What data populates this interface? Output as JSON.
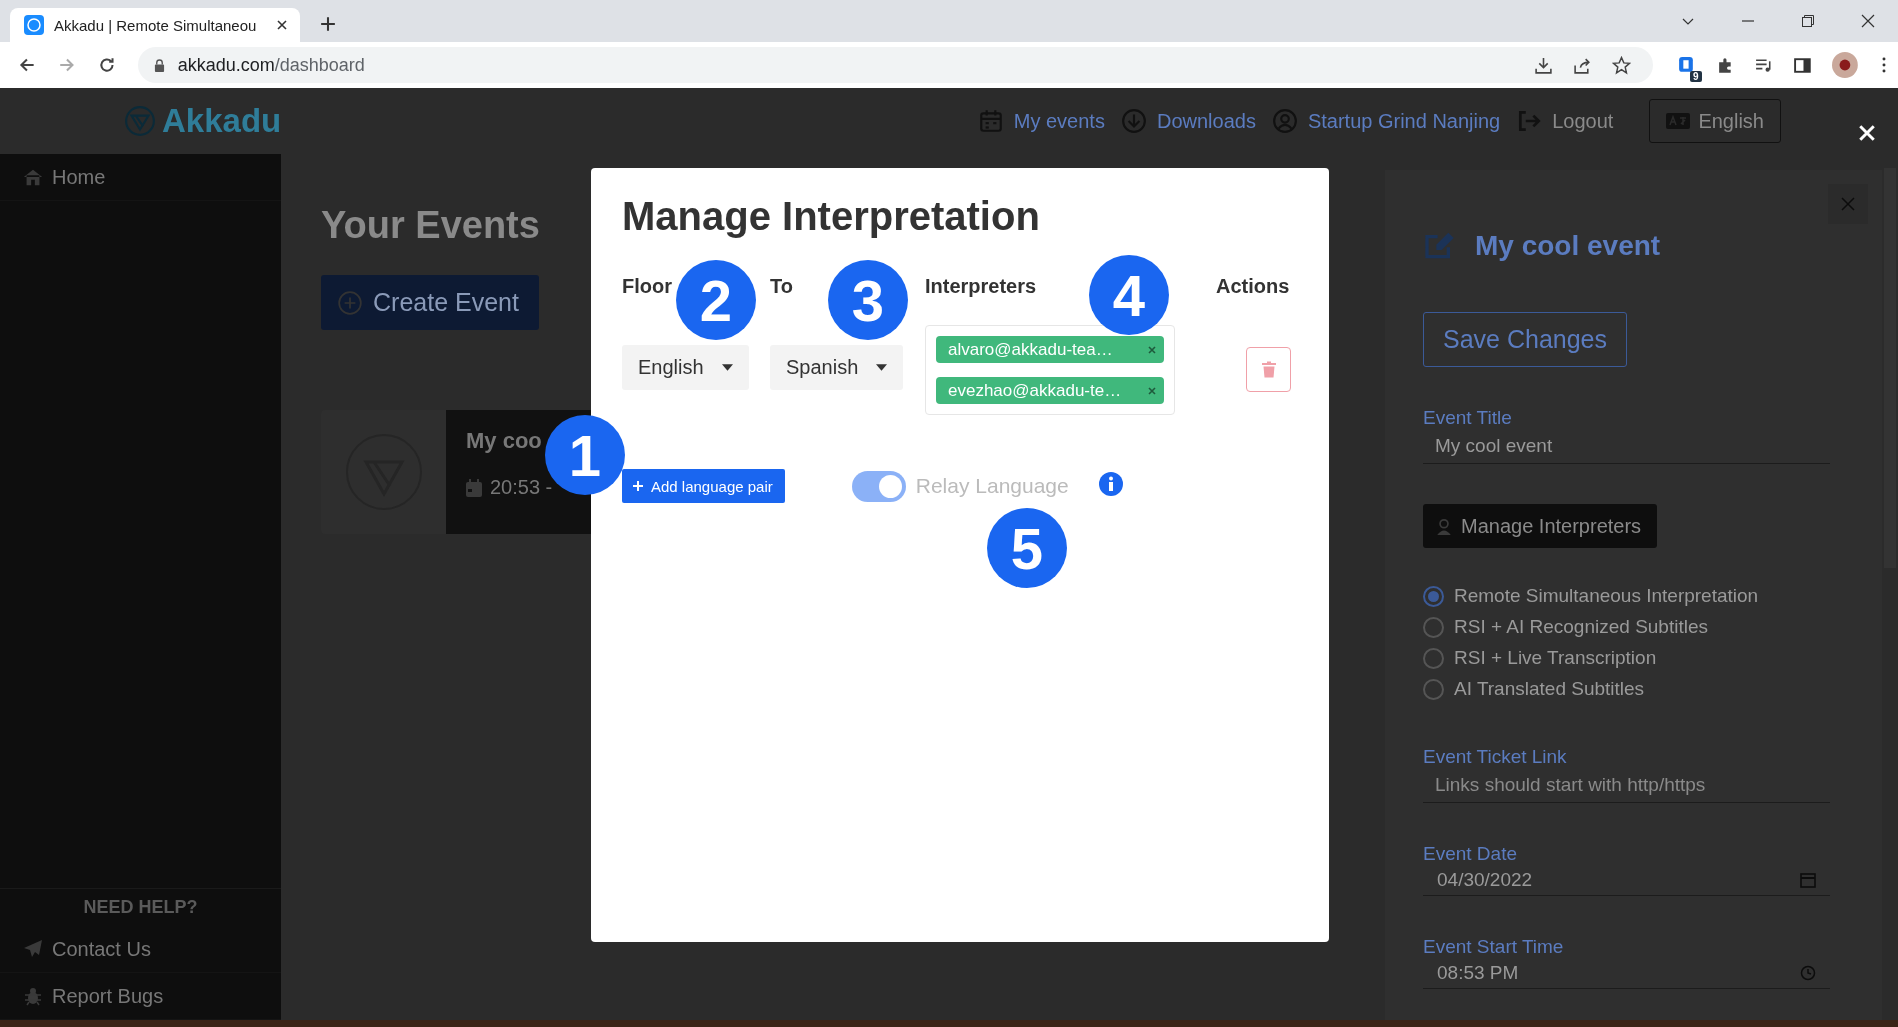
{
  "browser": {
    "tab_title": "Akkadu | Remote Simultaneou",
    "url_host": "akkadu.com",
    "url_path": "/dashboard",
    "extension_badge": "9"
  },
  "app_header": {
    "logo": "Akkadu",
    "nav": [
      {
        "label": "My events"
      },
      {
        "label": "Downloads"
      },
      {
        "label": "Startup Grind Nanjing"
      },
      {
        "label": "Logout"
      }
    ],
    "language_button": "English"
  },
  "sidebar": {
    "items": [
      "Home"
    ],
    "help_heading": "NEED HELP?",
    "help_items": [
      {
        "label": "Contact Us"
      },
      {
        "label": "Report Bugs"
      }
    ]
  },
  "main": {
    "title": "Your Events",
    "create_button": "Create Event",
    "event_card": {
      "title": "My coo",
      "time": "20:53 -"
    }
  },
  "event_panel": {
    "title": "My cool event",
    "save_button": "Save Changes",
    "title_label": "Event Title",
    "title_value": "My cool event",
    "manage_button": "Manage Interpreters",
    "modes": [
      {
        "label": "Remote Simultaneous Interpretation",
        "selected": true
      },
      {
        "label": "RSI + AI Recognized Subtitles",
        "selected": false
      },
      {
        "label": "RSI + Live Transcription",
        "selected": false
      },
      {
        "label": "AI Translated Subtitles",
        "selected": false
      }
    ],
    "ticket_label": "Event Ticket Link",
    "ticket_placeholder": "Links should start with http/https",
    "date_label": "Event Date",
    "date_value": "04/30/2022",
    "start_label": "Event Start Time",
    "start_value": "08:53 PM"
  },
  "modal": {
    "title": "Manage Interpretation",
    "columns": [
      "Floor",
      "To",
      "Interpreters",
      "Actions"
    ],
    "pairs": [
      {
        "floor": "English",
        "to": "Spanish",
        "interpreters": [
          "alvaro@akkadu-tea…",
          "evezhao@akkadu-te…"
        ]
      }
    ],
    "add_button": "Add language pair",
    "relay": {
      "label": "Relay Language",
      "on": true,
      "disabled": true
    }
  },
  "callouts": [
    "1",
    "2",
    "3",
    "4",
    "5"
  ]
}
